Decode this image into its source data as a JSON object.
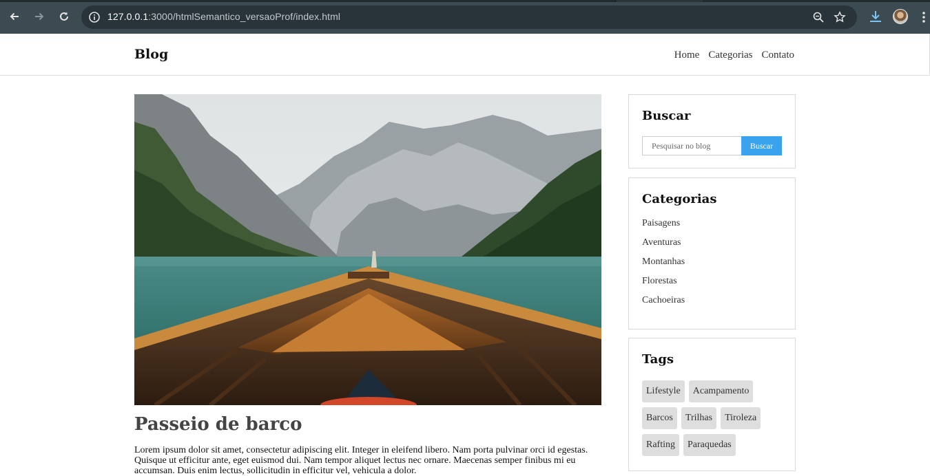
{
  "browser": {
    "url_host": "127.0.0.1",
    "url_path": ":3000/htmlSemantico_versaoProf/index.html"
  },
  "header": {
    "logo": "Blog",
    "nav": [
      "Home",
      "Categorias",
      "Contato"
    ]
  },
  "post": {
    "title": "Passeio de barco",
    "body": "Lorem ipsum dolor sit amet, consectetur adipiscing elit. Integer in eleifend libero. Nam porta pulvinar orci id egestas. Quisque ut efficitur ante, eget euismod dui. Nam tempor aliquet lectus nec ornare. Maecenas semper finibus mi eu accumsan. Duis enim lectus, sollicitudin in efficitur vel, vehicula a dolor."
  },
  "sidebar": {
    "search": {
      "title": "Buscar",
      "placeholder": "Pesquisar no blog",
      "button": "Buscar"
    },
    "categories": {
      "title": "Categorias",
      "items": [
        "Paisagens",
        "Aventuras",
        "Montanhas",
        "Florestas",
        "Cachoeiras"
      ]
    },
    "tags": {
      "title": "Tags",
      "items": [
        "Lifestyle",
        "Acampamento",
        "Barcos",
        "Trilhas",
        "Tiroleza",
        "Rafting",
        "Paraquedas"
      ]
    }
  },
  "colors": {
    "accent": "#3aa3ee",
    "chrome": "#3c4a52"
  }
}
